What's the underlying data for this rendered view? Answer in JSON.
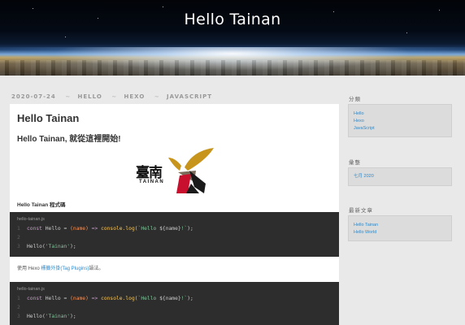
{
  "site": {
    "title": "Hello Tainan"
  },
  "meta": {
    "date": "2020-07-24",
    "tags": [
      "HELLO",
      "HEXO",
      "JAVASCRIPT"
    ]
  },
  "post": {
    "title": "Hello Tainan",
    "subtitle": "Hello Tainan, 就從這裡開始!",
    "logo_text": "臺南",
    "logo_caption": "TAINAN",
    "section_label": "Hello Tainan 程式碼",
    "code_blocks": [
      {
        "filename": "hello-tainan.js",
        "line_numbers": [
          "1",
          "2",
          "3"
        ],
        "line1": {
          "kw": "const",
          "name": "Hello",
          "eq": "=",
          "param": "(name)",
          "arrow": "=>",
          "call": "console.log(",
          "str_open": "`Hello ",
          "interp": "${name}",
          "str_close": "!`",
          "end": ");"
        },
        "line3": {
          "call": "Hello(",
          "str": "'Tainan'",
          "end": ");"
        }
      },
      {
        "filename": "hello-tainan.js",
        "line_numbers": [
          "1",
          "2",
          "3"
        ],
        "line1": {
          "kw": "const",
          "name": "Hello",
          "eq": "=",
          "param": "(name)",
          "arrow": "=>",
          "call": "console.log(",
          "str_open": "`Hello ",
          "interp": "${name}",
          "str_close": "!`",
          "end": ");"
        },
        "line3": {
          "call": "Hello(",
          "str": "'Tainan'",
          "end": ");"
        }
      }
    ],
    "paragraph": {
      "before": "使用 Hexo ",
      "link": "標籤外掛(Tag Plugins)",
      "after": "語法。"
    }
  },
  "sidebar": {
    "categories": {
      "heading": "分類",
      "items": [
        "Hello",
        "Hexo",
        "JavaScript"
      ]
    },
    "archives": {
      "heading": "彙整",
      "items": [
        "七月 2020"
      ]
    },
    "recent": {
      "heading": "最新文章",
      "items": [
        "Hello Tainan",
        "Hello World"
      ]
    }
  },
  "colors": {
    "accent": "#2a8bd0",
    "logo_gold": "#c8951c",
    "logo_red": "#c8102e",
    "code_bg": "#2d2d2d"
  }
}
